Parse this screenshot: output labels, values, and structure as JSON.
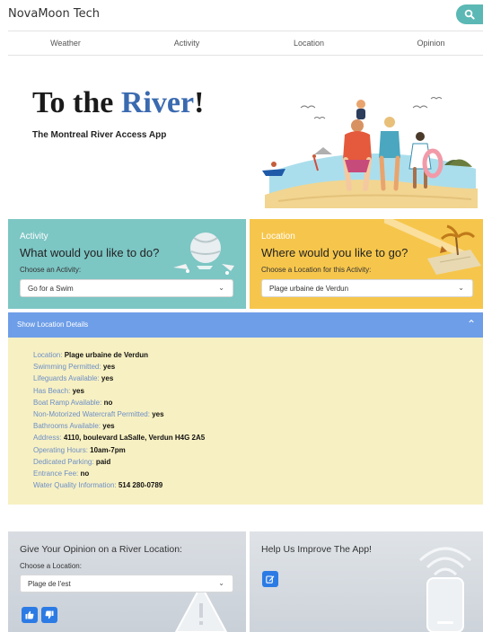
{
  "app": {
    "brand": "NovaMoon Tech"
  },
  "nav": [
    {
      "label": "Weather"
    },
    {
      "label": "Activity"
    },
    {
      "label": "Location"
    },
    {
      "label": "Opinion"
    }
  ],
  "hero": {
    "title_part1": "To the ",
    "title_accent": "River",
    "title_end": "!",
    "subtitle": "The Montreal River Access App"
  },
  "activity": {
    "kicker": "Activity",
    "question": "What would you like to do?",
    "select_label": "Choose an Activity:",
    "selected": "Go for a Swim"
  },
  "location": {
    "kicker": "Location",
    "question": "Where would you like to go?",
    "select_label": "Choose a Location for this Activity:",
    "selected": "Plage urbaine de Verdun"
  },
  "details": {
    "toggle_label": "Show Location Details",
    "items": [
      {
        "key": "Location",
        "value": "Plage urbaine de Verdun"
      },
      {
        "key": "Swimming Permitted",
        "value": "yes"
      },
      {
        "key": "Lifeguards Available",
        "value": "yes"
      },
      {
        "key": "Has Beach",
        "value": "yes"
      },
      {
        "key": "Boat Ramp Available",
        "value": "no"
      },
      {
        "key": "Non-Motorized Watercraft Permitted",
        "value": "yes"
      },
      {
        "key": "Bathrooms Available",
        "value": "yes"
      },
      {
        "key": "Address",
        "value": "4110, boulevard LaSalle, Verdun H4G 2A5"
      },
      {
        "key": "Operating Hours",
        "value": "10am-7pm"
      },
      {
        "key": "Dedicated Parking",
        "value": "paid"
      },
      {
        "key": "Entrance Fee",
        "value": "no"
      },
      {
        "key": "Water Quality Information",
        "value": "514 280-0789"
      }
    ]
  },
  "opinion": {
    "title": "Give Your Opinion on a River Location:",
    "select_label": "Choose a Location:",
    "selected": "Plage de l'est"
  },
  "help": {
    "title": "Help Us Improve The App!"
  },
  "colors": {
    "teal": "#7cc6c4",
    "yellow": "#f6c64c",
    "blue_header": "#6e9ee8",
    "details_bg": "#f7f0c2",
    "accent_blue": "#3a6ab0",
    "button_blue": "#2c7be5"
  },
  "icons": {
    "search": "search-icon",
    "chevron": "chevron-down-icon",
    "chevron_up": "chevron-up-icon",
    "thumbs_up": "thumbs-up-icon",
    "thumbs_down": "thumbs-down-icon",
    "edit": "edit-icon"
  }
}
